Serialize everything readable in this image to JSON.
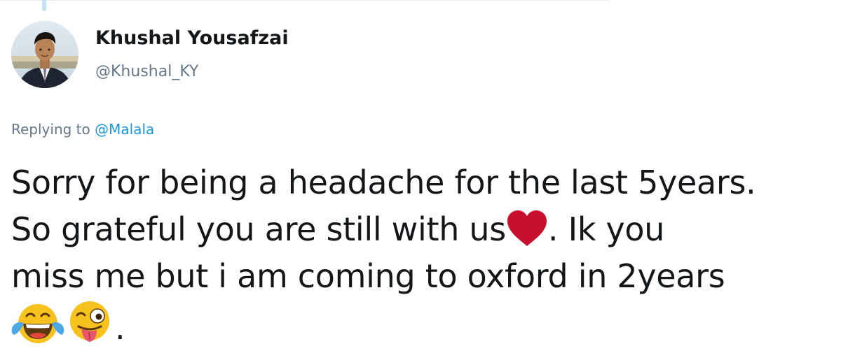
{
  "tweet": {
    "author": {
      "display_name": "Khushal Yousafzai",
      "handle": "@Khushal_KY",
      "avatar_icon": "profile-photo"
    },
    "reply_context": {
      "prefix": "Replying to",
      "mention": "@Malala"
    },
    "text": {
      "line1": "Sorry for being a headache for the last 5years.",
      "line2_before": "So grateful you are still with us",
      "line2_emoji": "red-heart",
      "line2_after": ". Ik you",
      "line3": "miss me but i am coming to oxford in 2years",
      "line4_emojis": [
        "face-with-tears-of-joy",
        "winking-face-with-tongue"
      ],
      "line4_after": "."
    }
  },
  "colors": {
    "text": "#14171a",
    "secondary": "#657786",
    "link": "#1b95e0",
    "heart": "#c8102e",
    "emoji_yellow": "#f7c11e",
    "thread_line": "#c4e0f3"
  }
}
